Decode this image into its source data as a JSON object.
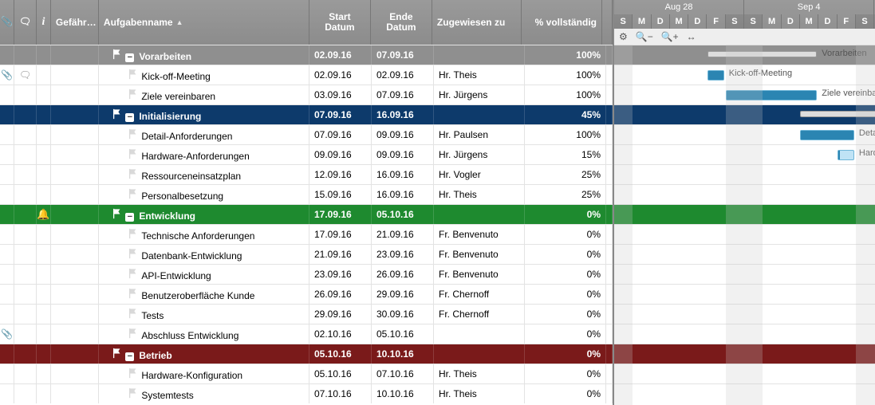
{
  "columns": {
    "info_symbol": "i",
    "gefahr": "Gefähr…",
    "name": "Aufgabenname",
    "start": "Start Datum",
    "end": "Ende Datum",
    "assigned": "Zugewiesen zu",
    "pct": "% vollständig"
  },
  "timeline": {
    "months": [
      {
        "label": "Aug 28",
        "span_days": 7
      },
      {
        "label": "Sep 4",
        "span_days": 7
      }
    ],
    "day_letters": [
      "S",
      "M",
      "D",
      "M",
      "D",
      "F",
      "S",
      "S",
      "M",
      "D",
      "M",
      "D",
      "F",
      "S",
      "S"
    ],
    "weekend_indices": [
      0,
      6,
      7,
      13,
      14
    ],
    "start_date": "2016-08-28",
    "toolbar_icons": [
      "gear-icon",
      "zoom-out-icon",
      "zoom-in-icon",
      "fit-icon"
    ]
  },
  "rows": [
    {
      "type": "group",
      "color": "gray",
      "name": "Vorarbeiten",
      "start": "02.09.16",
      "end": "07.09.16",
      "assigned": "",
      "pct": "100%",
      "level": 1,
      "bar": {
        "kind": "summary",
        "from": "2016-09-02",
        "to": "2016-09-07",
        "progress": 100,
        "label": "Vorarbeiten"
      }
    },
    {
      "type": "task",
      "name": "Kick-off-Meeting",
      "start": "02.09.16",
      "end": "02.09.16",
      "assigned": "Hr. Theis",
      "pct": "100%",
      "level": 2,
      "attach": true,
      "comment": true,
      "bar": {
        "kind": "task",
        "from": "2016-09-02",
        "to": "2016-09-02",
        "progress": 100,
        "label": "Kick-off-Meeting"
      }
    },
    {
      "type": "task",
      "name": "Ziele vereinbaren",
      "start": "03.09.16",
      "end": "07.09.16",
      "assigned": "Hr. Jürgens",
      "pct": "100%",
      "level": 2,
      "bar": {
        "kind": "task",
        "from": "2016-09-03",
        "to": "2016-09-07",
        "progress": 100,
        "label": "Ziele vereinbaren"
      }
    },
    {
      "type": "group",
      "color": "blue",
      "name": "Initialisierung",
      "start": "07.09.16",
      "end": "16.09.16",
      "assigned": "",
      "pct": "45%",
      "level": 1,
      "bar": {
        "kind": "summary",
        "from": "2016-09-07",
        "to": "2016-09-16",
        "progress": 45,
        "label": ""
      }
    },
    {
      "type": "task",
      "name": "Detail-Anforderungen",
      "start": "07.09.16",
      "end": "09.09.16",
      "assigned": "Hr. Paulsen",
      "pct": "100%",
      "level": 2,
      "bar": {
        "kind": "task",
        "from": "2016-09-07",
        "to": "2016-09-09",
        "progress": 100,
        "label": "Detail-A"
      }
    },
    {
      "type": "task",
      "name": "Hardware-Anforderungen",
      "start": "09.09.16",
      "end": "09.09.16",
      "assigned": "Hr. Jürgens",
      "pct": "15%",
      "level": 2,
      "bar": {
        "kind": "task",
        "from": "2016-09-09",
        "to": "2016-09-09",
        "progress": 15,
        "label": "Hardwa"
      }
    },
    {
      "type": "task",
      "name": "Ressourceneinsatzplan",
      "start": "12.09.16",
      "end": "16.09.16",
      "assigned": "Hr. Vogler",
      "pct": "25%",
      "level": 2
    },
    {
      "type": "task",
      "name": "Personalbesetzung",
      "start": "15.09.16",
      "end": "16.09.16",
      "assigned": "Hr. Theis",
      "pct": "25%",
      "level": 2
    },
    {
      "type": "group",
      "color": "green",
      "name": "Entwicklung",
      "start": "17.09.16",
      "end": "05.10.16",
      "assigned": "",
      "pct": "0%",
      "level": 1,
      "bell": true
    },
    {
      "type": "task",
      "name": "Technische Anforderungen",
      "start": "17.09.16",
      "end": "21.09.16",
      "assigned": "Fr. Benvenuto",
      "pct": "0%",
      "level": 2
    },
    {
      "type": "task",
      "name": "Datenbank-Entwicklung",
      "start": "21.09.16",
      "end": "23.09.16",
      "assigned": "Fr. Benvenuto",
      "pct": "0%",
      "level": 2
    },
    {
      "type": "task",
      "name": "API-Entwicklung",
      "start": "23.09.16",
      "end": "26.09.16",
      "assigned": "Fr. Benvenuto",
      "pct": "0%",
      "level": 2
    },
    {
      "type": "task",
      "name": "Benutzeroberfläche Kunde",
      "start": "26.09.16",
      "end": "29.09.16",
      "assigned": "Fr. Chernoff",
      "pct": "0%",
      "level": 2
    },
    {
      "type": "task",
      "name": "Tests",
      "start": "29.09.16",
      "end": "30.09.16",
      "assigned": "Fr. Chernoff",
      "pct": "0%",
      "level": 2
    },
    {
      "type": "task",
      "name": "Abschluss Entwicklung",
      "start": "02.10.16",
      "end": "05.10.16",
      "assigned": "",
      "pct": "0%",
      "level": 2,
      "attach": true
    },
    {
      "type": "group",
      "color": "red",
      "name": "Betrieb",
      "start": "05.10.16",
      "end": "10.10.16",
      "assigned": "",
      "pct": "0%",
      "level": 1
    },
    {
      "type": "task",
      "name": "Hardware-Konfiguration",
      "start": "05.10.16",
      "end": "07.10.16",
      "assigned": "Hr. Theis",
      "pct": "0%",
      "level": 2
    },
    {
      "type": "task",
      "name": "Systemtests",
      "start": "07.10.16",
      "end": "10.10.16",
      "assigned": "Hr. Theis",
      "pct": "0%",
      "level": 2
    }
  ]
}
